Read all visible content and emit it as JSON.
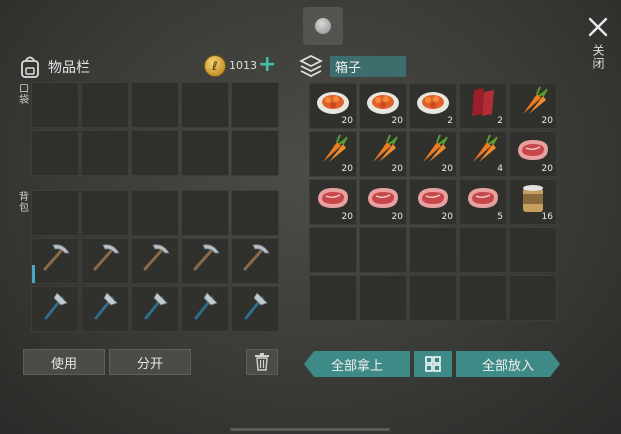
{
  "header": {
    "inventory_title": "物品栏",
    "coins": "1013",
    "close_label": "关闭",
    "box_title": "箱子"
  },
  "labels": {
    "pocket": "口袋",
    "backpack": "背包"
  },
  "buttons": {
    "use": "使用",
    "split": "分开",
    "take_all": "全部拿上",
    "put_all": "全部放入"
  },
  "colors": {
    "accent": "#3e8a86",
    "coin": "#e0b04a",
    "plus": "#3fc0a6"
  },
  "pocket_slots": [
    "",
    "",
    "",
    "",
    "",
    "",
    "",
    "",
    "",
    ""
  ],
  "backpack_slots": [
    {
      "item": ""
    },
    {
      "item": ""
    },
    {
      "item": ""
    },
    {
      "item": ""
    },
    {
      "item": ""
    },
    {
      "item": "pickaxe-icon",
      "selected": true
    },
    {
      "item": "pickaxe-icon"
    },
    {
      "item": "pickaxe-icon"
    },
    {
      "item": "pickaxe-icon"
    },
    {
      "item": "pickaxe-icon"
    },
    {
      "item": "hatchet-icon"
    },
    {
      "item": "hatchet-icon"
    },
    {
      "item": "hatchet-icon"
    },
    {
      "item": "hatchet-icon"
    },
    {
      "item": "hatchet-icon"
    }
  ],
  "box_slots": [
    {
      "item": "cooked-carrot-plate-icon",
      "count": "20"
    },
    {
      "item": "cooked-carrot-plate-icon",
      "count": "20"
    },
    {
      "item": "cooked-carrot-plate-icon",
      "count": "2"
    },
    {
      "item": "raw-meat-icon",
      "count": "2"
    },
    {
      "item": "carrot-icon",
      "count": "20"
    },
    {
      "item": "carrot-icon",
      "count": "20"
    },
    {
      "item": "carrot-icon",
      "count": "20"
    },
    {
      "item": "carrot-icon",
      "count": "20"
    },
    {
      "item": "carrot-icon",
      "count": "4"
    },
    {
      "item": "steak-icon",
      "count": "20"
    },
    {
      "item": "steak-icon",
      "count": "20"
    },
    {
      "item": "steak-icon",
      "count": "20"
    },
    {
      "item": "steak-icon",
      "count": "20"
    },
    {
      "item": "steak-icon",
      "count": "5"
    },
    {
      "item": "canned-food-icon",
      "count": "16"
    },
    {
      "item": "",
      "count": ""
    },
    {
      "item": "",
      "count": ""
    },
    {
      "item": "",
      "count": ""
    },
    {
      "item": "",
      "count": ""
    },
    {
      "item": "",
      "count": ""
    },
    {
      "item": "",
      "count": ""
    },
    {
      "item": "",
      "count": ""
    },
    {
      "item": "",
      "count": ""
    },
    {
      "item": "",
      "count": ""
    },
    {
      "item": "",
      "count": ""
    }
  ]
}
